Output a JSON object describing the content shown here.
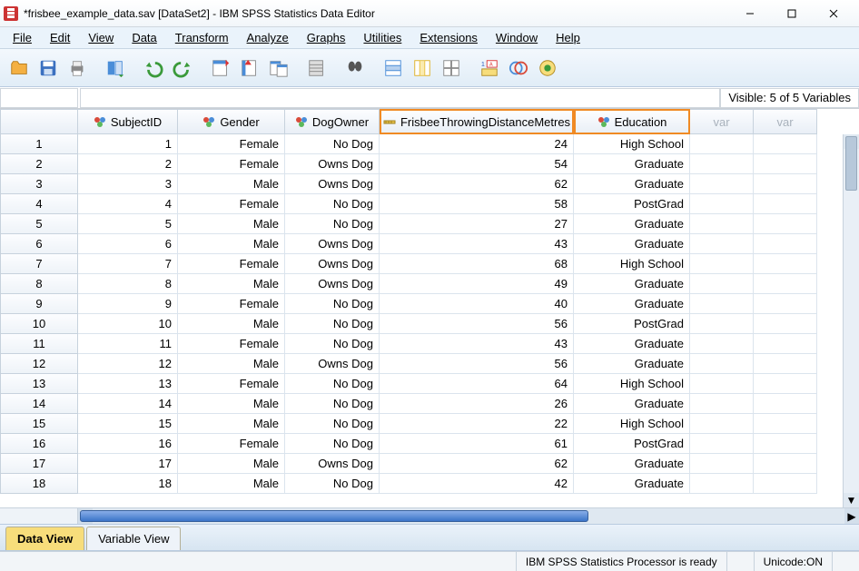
{
  "window": {
    "title": "*frisbee_example_data.sav [DataSet2] - IBM SPSS Statistics Data Editor"
  },
  "menu": {
    "file": "File",
    "edit": "Edit",
    "view": "View",
    "data": "Data",
    "transform": "Transform",
    "analyze": "Analyze",
    "graphs": "Graphs",
    "utilities": "Utilities",
    "extensions": "Extensions",
    "window": "Window",
    "help": "Help"
  },
  "visible_info": "Visible: 5 of 5 Variables",
  "columns": {
    "c1": "SubjectID",
    "c2": "Gender",
    "c3": "DogOwner",
    "c4": "FrisbeeThrowingDistanceMetres",
    "c5": "Education",
    "var": "var"
  },
  "rows": [
    {
      "n": "1",
      "SubjectID": "1",
      "Gender": "Female",
      "DogOwner": "No Dog",
      "Frisbee": "24",
      "Education": "High School"
    },
    {
      "n": "2",
      "SubjectID": "2",
      "Gender": "Female",
      "DogOwner": "Owns Dog",
      "Frisbee": "54",
      "Education": "Graduate"
    },
    {
      "n": "3",
      "SubjectID": "3",
      "Gender": "Male",
      "DogOwner": "Owns Dog",
      "Frisbee": "62",
      "Education": "Graduate"
    },
    {
      "n": "4",
      "SubjectID": "4",
      "Gender": "Female",
      "DogOwner": "No Dog",
      "Frisbee": "58",
      "Education": "PostGrad"
    },
    {
      "n": "5",
      "SubjectID": "5",
      "Gender": "Male",
      "DogOwner": "No Dog",
      "Frisbee": "27",
      "Education": "Graduate"
    },
    {
      "n": "6",
      "SubjectID": "6",
      "Gender": "Male",
      "DogOwner": "Owns Dog",
      "Frisbee": "43",
      "Education": "Graduate"
    },
    {
      "n": "7",
      "SubjectID": "7",
      "Gender": "Female",
      "DogOwner": "Owns Dog",
      "Frisbee": "68",
      "Education": "High School"
    },
    {
      "n": "8",
      "SubjectID": "8",
      "Gender": "Male",
      "DogOwner": "Owns Dog",
      "Frisbee": "49",
      "Education": "Graduate"
    },
    {
      "n": "9",
      "SubjectID": "9",
      "Gender": "Female",
      "DogOwner": "No Dog",
      "Frisbee": "40",
      "Education": "Graduate"
    },
    {
      "n": "10",
      "SubjectID": "10",
      "Gender": "Male",
      "DogOwner": "No Dog",
      "Frisbee": "56",
      "Education": "PostGrad"
    },
    {
      "n": "11",
      "SubjectID": "11",
      "Gender": "Female",
      "DogOwner": "No Dog",
      "Frisbee": "43",
      "Education": "Graduate"
    },
    {
      "n": "12",
      "SubjectID": "12",
      "Gender": "Male",
      "DogOwner": "Owns Dog",
      "Frisbee": "56",
      "Education": "Graduate"
    },
    {
      "n": "13",
      "SubjectID": "13",
      "Gender": "Female",
      "DogOwner": "No Dog",
      "Frisbee": "64",
      "Education": "High School"
    },
    {
      "n": "14",
      "SubjectID": "14",
      "Gender": "Male",
      "DogOwner": "No Dog",
      "Frisbee": "26",
      "Education": "Graduate"
    },
    {
      "n": "15",
      "SubjectID": "15",
      "Gender": "Male",
      "DogOwner": "No Dog",
      "Frisbee": "22",
      "Education": "High School"
    },
    {
      "n": "16",
      "SubjectID": "16",
      "Gender": "Female",
      "DogOwner": "No Dog",
      "Frisbee": "61",
      "Education": "PostGrad"
    },
    {
      "n": "17",
      "SubjectID": "17",
      "Gender": "Male",
      "DogOwner": "Owns Dog",
      "Frisbee": "62",
      "Education": "Graduate"
    },
    {
      "n": "18",
      "SubjectID": "18",
      "Gender": "Male",
      "DogOwner": "No Dog",
      "Frisbee": "42",
      "Education": "Graduate"
    }
  ],
  "tabs": {
    "data_view": "Data View",
    "variable_view": "Variable View"
  },
  "status": {
    "processor": "IBM SPSS Statistics Processor is ready",
    "unicode": "Unicode:ON"
  }
}
